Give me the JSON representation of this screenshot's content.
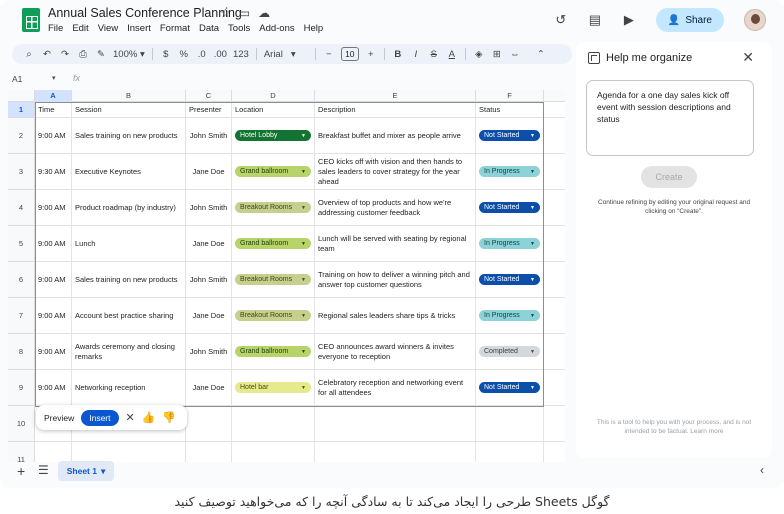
{
  "header": {
    "doc_title": "Annual Sales Conference Planning",
    "menu": [
      "File",
      "Edit",
      "View",
      "Insert",
      "Format",
      "Data",
      "Tools",
      "Add-ons",
      "Help"
    ],
    "share_label": "Share"
  },
  "toolbar": {
    "zoom": "100%",
    "currency": "$",
    "percent": "%",
    "decimal_less": ".0",
    "decimal_more": ".00",
    "number_format": "123",
    "font": "Arial",
    "font_size": "10",
    "minus": "−",
    "plus": "+",
    "bold": "B",
    "italic": "I",
    "strike": "S",
    "text_color": "A"
  },
  "formula_bar": {
    "name_box": "A1",
    "fx": "fx"
  },
  "grid": {
    "columns": [
      "A",
      "B",
      "C",
      "D",
      "E",
      "F"
    ],
    "header_row": [
      "Time",
      "Session",
      "Presenter",
      "Location",
      "Description",
      "Status"
    ],
    "rows": [
      {
        "num": "2",
        "time": "9:00 AM",
        "session": "Sales training on new products",
        "presenter": "John Smith",
        "location": "Hotel Lobby",
        "location_style": "dkgreen",
        "description": "Breakfast buffet and mixer as people arrive",
        "status": "Not Started",
        "status_style": "navy"
      },
      {
        "num": "3",
        "time": "9:30 AM",
        "session": "Executive Keynotes",
        "presenter": "Jane Doe",
        "location": "Grand ballroom",
        "location_style": "green",
        "description": "CEO kicks off with vision and then hands to sales leaders to cover strategy for the year ahead",
        "status": "In Progress",
        "status_style": "teal"
      },
      {
        "num": "4",
        "time": "9:00 AM",
        "session": "Product roadmap (by industry)",
        "presenter": "John Smith",
        "location": "Breakout Rooms",
        "location_style": "olive",
        "description": "Overview of top products and how we're addressing customer feedback",
        "status": "Not Started",
        "status_style": "navy"
      },
      {
        "num": "5",
        "time": "9:00 AM",
        "session": "Lunch",
        "presenter": "Jane Doe",
        "location": "Grand ballroom",
        "location_style": "green",
        "description": "Lunch will be served with seating by regional team",
        "status": "In Progress",
        "status_style": "teal"
      },
      {
        "num": "6",
        "time": "9:00 AM",
        "session": "Sales training on new products",
        "presenter": "John Smith",
        "location": "Breakout Rooms",
        "location_style": "olive",
        "description": "Training on how to deliver a winning pitch and answer top customer questions",
        "status": "Not Started",
        "status_style": "navy"
      },
      {
        "num": "7",
        "time": "9:00 AM",
        "session": "Account best practice sharing",
        "presenter": "Jane Doe",
        "location": "Breakout Rooms",
        "location_style": "olive",
        "description": "Regional sales leaders share tips & tricks",
        "status": "In Progress",
        "status_style": "teal"
      },
      {
        "num": "8",
        "time": "9:00 AM",
        "session": "Awards ceremony and closing remarks",
        "presenter": "John Smith",
        "location": "Grand ballroom",
        "location_style": "green",
        "description": "CEO announces award winners & invites everyone to reception",
        "status": "Completed",
        "status_style": "gray"
      },
      {
        "num": "9",
        "time": "9:00 AM",
        "session": "Networking reception",
        "presenter": "Jane Doe",
        "location": "Hotel bar",
        "location_style": "ltgreen",
        "description": "Celebratory reception and networking event for all attendees",
        "status": "Not Started",
        "status_style": "navy"
      }
    ],
    "row_numbers": [
      "1",
      "2",
      "3",
      "4",
      "5",
      "6",
      "7",
      "8",
      "9",
      "10",
      "11"
    ]
  },
  "action_bar": {
    "preview": "Preview",
    "insert": "Insert"
  },
  "sheet_tabs": {
    "active": "Sheet 1"
  },
  "side_panel": {
    "title": "Help me organize",
    "prompt": "Agenda for a one day sales kick off event with session descriptions and status",
    "create_label": "Create",
    "hint": "Continue refining by editing your original request and clicking on “Create”.",
    "disclaimer": "This is a tool to help you with your process, and is not intended to be factual. Learn more"
  },
  "caption": "گوگل Sheets طرحی را ایجاد می‌کند تا به سادگی آنچه را که می‌خواهید توصیف کنید",
  "colors": {
    "share_bg": "#c2e7ff",
    "insert_bg": "#0b57d0",
    "selection": "#d3e3fd"
  }
}
